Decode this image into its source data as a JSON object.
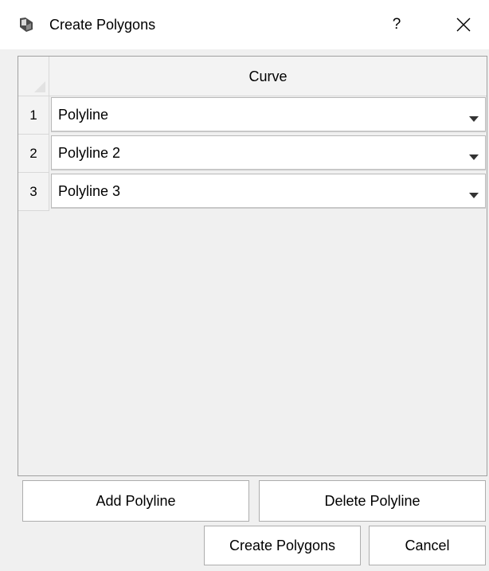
{
  "window": {
    "title": "Create Polygons",
    "help_label": "?",
    "icon": "polygon-shape-icon",
    "close_icon": "close-icon"
  },
  "table": {
    "column_header": "Curve",
    "rows": [
      {
        "number": "1",
        "value": "Polyline"
      },
      {
        "number": "2",
        "value": "Polyline 2"
      },
      {
        "number": "3",
        "value": "Polyline 3"
      }
    ]
  },
  "buttons": {
    "add": "Add Polyline",
    "delete": "Delete Polyline",
    "create": "Create Polygons",
    "cancel": "Cancel"
  },
  "colors": {
    "titlebar": "#ffffff",
    "dialog_bg": "#f0f0f0",
    "button_bg": "#ffffff"
  }
}
